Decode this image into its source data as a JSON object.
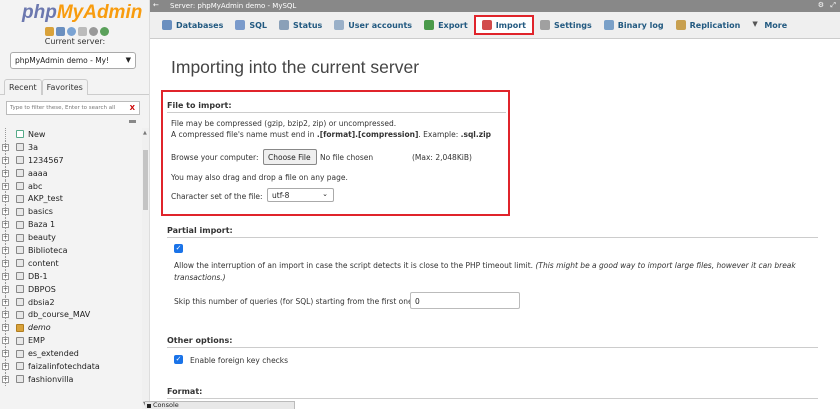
{
  "sidebar": {
    "logo_php": "php",
    "logo_myadmin": "MyAdmin",
    "current_server_label": "Current server:",
    "server_select": "phpMyAdmin demo - My!",
    "tabs": [
      "Recent",
      "Favorites"
    ],
    "filter_placeholder": "Type to filter these, Enter to search all",
    "filter_clear": "X",
    "new_label": "New",
    "databases": [
      "3a",
      "1234567",
      "aaaa",
      "abc",
      "AKP_test",
      "basics",
      "Baza 1",
      "beauty",
      "Biblioteca",
      "content",
      "DB-1",
      "DBPOS",
      "dbsia2",
      "db_course_MAV",
      "demo",
      "EMP",
      "es_extended",
      "faizalinfotechdata",
      "fashionvilla"
    ]
  },
  "titlebar": {
    "arrow": "←",
    "title": "Server: phpMyAdmin demo - MySQL",
    "gear": "⚙",
    "maximize": "⤢"
  },
  "menu": [
    {
      "label": "Databases",
      "icon": "database-icon",
      "color": "#6a8fbf"
    },
    {
      "label": "SQL",
      "icon": "sql-icon",
      "color": "#7a9acb"
    },
    {
      "label": "Status",
      "icon": "status-icon",
      "color": "#8aa0b8"
    },
    {
      "label": "User accounts",
      "icon": "users-icon",
      "color": "#9ab0c8"
    },
    {
      "label": "Export",
      "icon": "export-icon",
      "color": "#4a9a4a"
    },
    {
      "label": "Import",
      "icon": "import-icon",
      "color": "#d24a4a",
      "active": true
    },
    {
      "label": "Settings",
      "icon": "settings-icon",
      "color": "#a0a0a0"
    },
    {
      "label": "Binary log",
      "icon": "binary-log-icon",
      "color": "#7aa0c8"
    },
    {
      "label": "Replication",
      "icon": "replication-icon",
      "color": "#c8a050"
    },
    {
      "label": "More",
      "icon": "more-icon",
      "color": "#555555"
    }
  ],
  "main": {
    "title": "Importing into the current server",
    "file_to_import": {
      "heading": "File to import:",
      "line1": "File may be compressed (gzip, bzip2, zip) or uncompressed.",
      "line2_prefix": "A compressed file's name must end in ",
      "line2_format": ".[format].[compression]",
      "line2_mid": ". Example: ",
      "line2_example": ".sql.zip",
      "browse_label": "Browse your computer:",
      "choose_file": "Choose File",
      "no_file": "No file chosen",
      "max_size": "(Max: 2,048KiB)",
      "drag_drop": "You may also drag and drop a file on any page.",
      "charset_label": "Character set of the file:",
      "charset_value": "utf-8"
    },
    "partial_import": {
      "heading": "Partial import:",
      "allow_text": "Allow the interruption of an import in case the script detects it is close to the PHP timeout limit.",
      "allow_note1": "(This might be a good way to import large files, however it can break",
      "allow_note2": "transactions.)",
      "skip_label": "Skip this number of queries (for SQL) starting from the first one:",
      "skip_value": "0"
    },
    "other_options": {
      "heading": "Other options:",
      "fk_label": "Enable foreign key checks"
    },
    "format": {
      "heading": "Format:"
    }
  },
  "console": {
    "label": "Console"
  },
  "colors": {
    "highlight": "#e0242b",
    "link": "#235a81",
    "checkbox": "#1a73e8"
  }
}
